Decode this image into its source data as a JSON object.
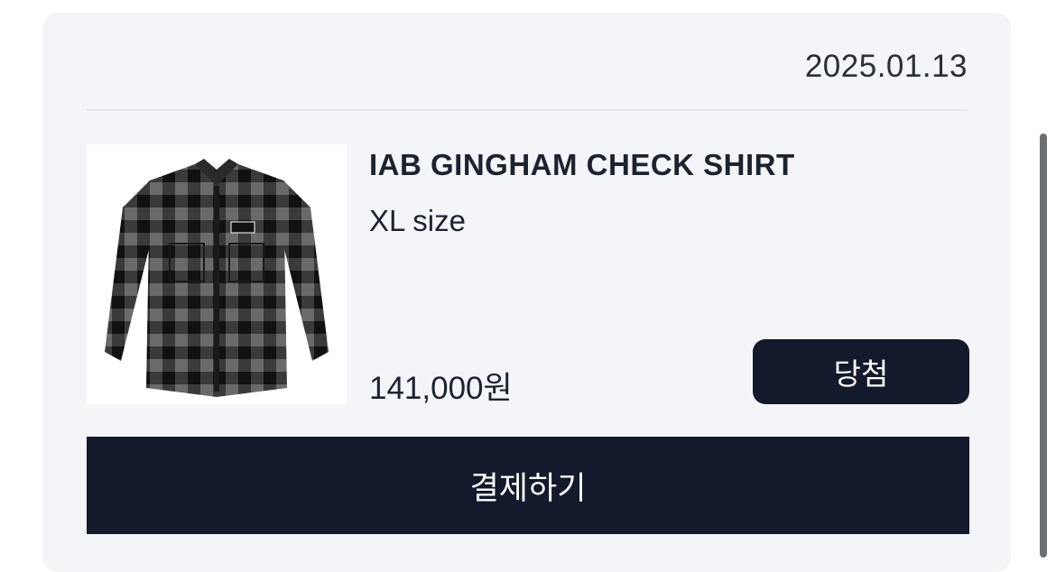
{
  "order": {
    "date": "2025.01.13",
    "product": {
      "name": "IAB GINGHAM CHECK SHIRT",
      "option": "XL size",
      "price": "141,000원",
      "status_badge": "당첨"
    },
    "pay_button_label": "결제하기"
  },
  "colors": {
    "card_bg": "#f3f5f8",
    "dark_button": "#121a2b",
    "text": "#1c2330"
  }
}
